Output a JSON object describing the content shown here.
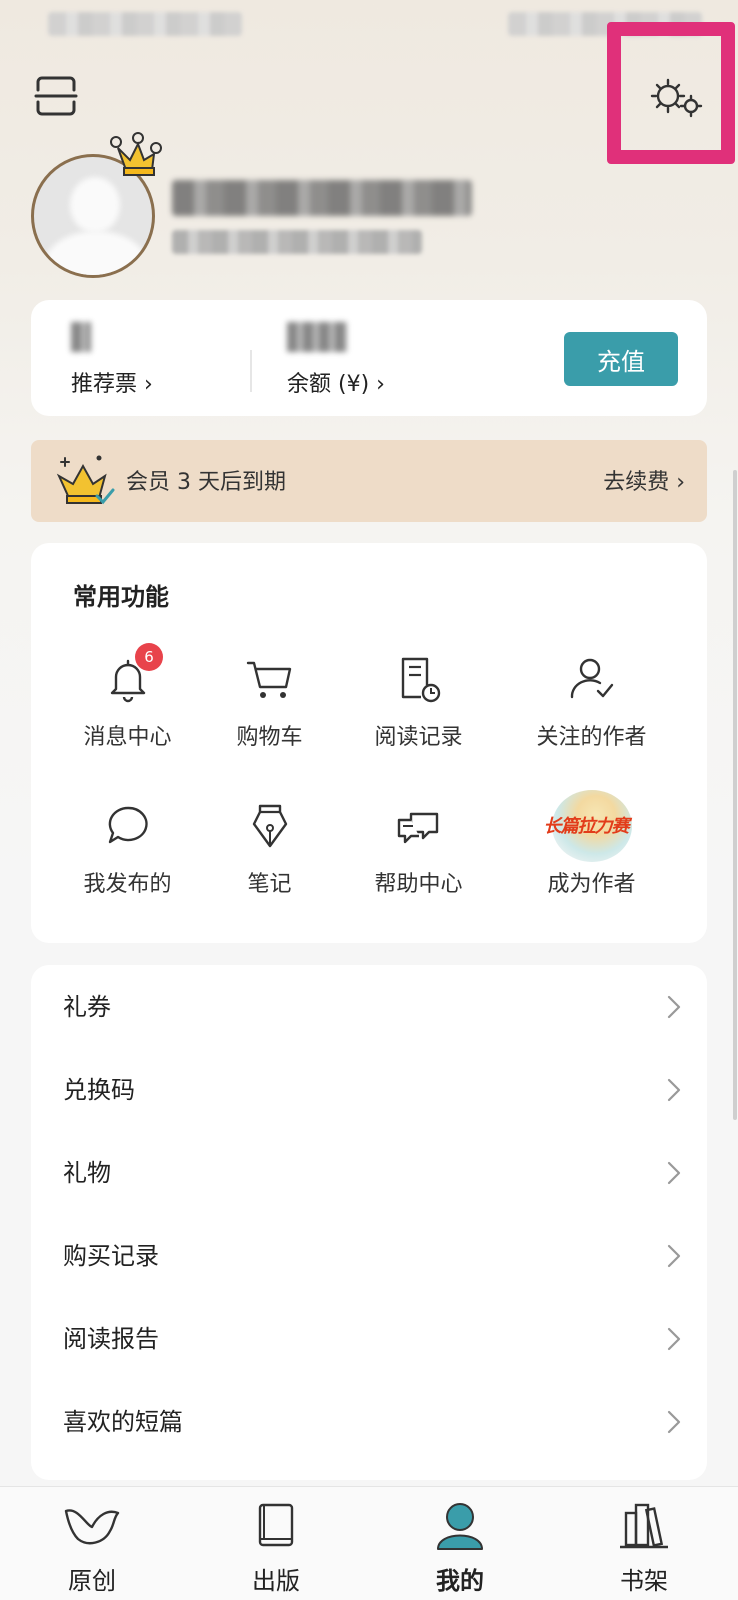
{
  "header": {
    "scan_icon": "scan-icon",
    "settings_icon": "settings-gears-icon"
  },
  "profile": {
    "avatar_icon": "default-avatar-icon",
    "crown_icon": "vip-crown-badge-icon"
  },
  "wallet": {
    "items": [
      {
        "label": "推荐票 ›"
      },
      {
        "label": "余额 (¥) ›"
      }
    ],
    "recharge_label": "充值"
  },
  "vip": {
    "text": "会员 3 天后到期",
    "renew_label": "去续费 ›"
  },
  "functions": {
    "title": "常用功能",
    "items": [
      {
        "label": "消息中心",
        "icon": "bell-icon",
        "badge": "6"
      },
      {
        "label": "购物车",
        "icon": "cart-icon"
      },
      {
        "label": "阅读记录",
        "icon": "reading-history-icon"
      },
      {
        "label": "关注的作者",
        "icon": "followed-author-icon"
      },
      {
        "label": "我发布的",
        "icon": "chat-bubble-icon"
      },
      {
        "label": "笔记",
        "icon": "pen-nib-icon"
      },
      {
        "label": "帮助中心",
        "icon": "help-chat-icon"
      },
      {
        "label": "成为作者",
        "icon": "become-author-logo",
        "logo_text": "长篇拉力赛"
      }
    ]
  },
  "menu": {
    "items": [
      {
        "label": "礼券"
      },
      {
        "label": "兑换码"
      },
      {
        "label": "礼物"
      },
      {
        "label": "购买记录"
      },
      {
        "label": "阅读报告"
      },
      {
        "label": "喜欢的短篇"
      }
    ]
  },
  "tabbar": {
    "active_color": "#3a9daa",
    "items": [
      {
        "label": "原创",
        "icon": "bird-icon"
      },
      {
        "label": "出版",
        "icon": "book-icon"
      },
      {
        "label": "我的",
        "icon": "user-profile-icon",
        "active": true
      },
      {
        "label": "书架",
        "icon": "bookshelf-icon"
      }
    ]
  }
}
